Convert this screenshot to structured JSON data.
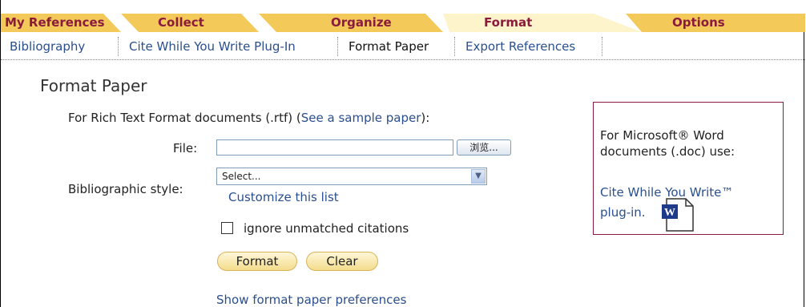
{
  "tabs": {
    "my_references": "My References",
    "collect": "Collect",
    "organize": "Organize",
    "format": "Format",
    "options": "Options"
  },
  "subnav": {
    "bibliography": "Bibliography",
    "cwyw": "Cite While You Write Plug-In",
    "format_paper": "Format Paper",
    "export": "Export References"
  },
  "page": {
    "title": "Format Paper",
    "intro_prefix": "For Rich Text Format documents (.rtf) (",
    "sample_link": "See a sample paper",
    "intro_suffix": "):",
    "file_label": "File:",
    "file_value": "",
    "browse_label": "浏览...",
    "style_label": "Bibliographic style:",
    "style_selected": "Select...",
    "customize_link": "Customize this list",
    "ignore_label": "ignore unmatched citations",
    "format_button": "Format",
    "clear_button": "Clear",
    "prefs_link": "Show format paper preferences"
  },
  "sidebar": {
    "line1": "For Microsoft® Word",
    "line2": "documents (.doc) use:",
    "link_line1": "Cite While You Write™",
    "link_line2": "plug-in."
  },
  "colors": {
    "tab_gold": "#f3c95a",
    "tab_text": "#8b1a3d",
    "link": "#2a4f8f",
    "panel_border": "#8b1a3d"
  }
}
